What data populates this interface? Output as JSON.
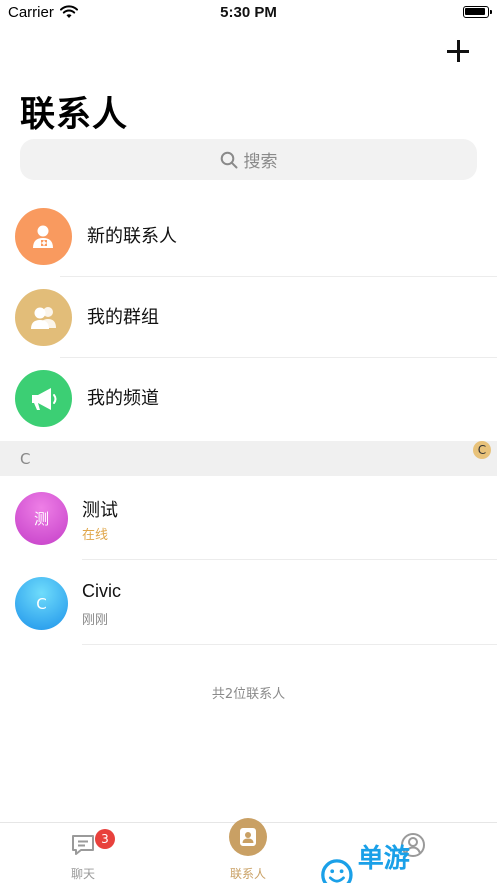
{
  "status_bar": {
    "carrier": "Carrier",
    "time": "5:30 PM"
  },
  "header": {
    "title": "联系人",
    "add_icon": "plus-icon"
  },
  "search": {
    "placeholder": "搜索",
    "icon": "search-icon"
  },
  "features": [
    {
      "label": "新的联系人",
      "icon": "add-user-icon",
      "color": "#f99a5f"
    },
    {
      "label": "我的群组",
      "icon": "group-icon",
      "color": "#e2bd79"
    },
    {
      "label": "我的频道",
      "icon": "megaphone-icon",
      "color": "#3ccf74"
    }
  ],
  "section": {
    "letter": "C",
    "index_badge": "C"
  },
  "contacts": [
    {
      "name": "测试",
      "status": "在线",
      "avatar_text": "测",
      "status_color": "#e0a64a"
    },
    {
      "name": "Civic",
      "status": "刚刚",
      "avatar_text": "C",
      "status_color": "#8a8a8a"
    }
  ],
  "total_text": "共2位联系人",
  "tabs": [
    {
      "label": "聊天",
      "badge": "3",
      "icon": "chat-icon",
      "active": false
    },
    {
      "label": "联系人",
      "icon": "contacts-icon",
      "active": true
    },
    {
      "label": "",
      "icon": "profile-icon",
      "active": false
    }
  ],
  "colors": {
    "accent": "#c9a064",
    "badge_red": "#e8413c"
  },
  "watermark": {
    "text": "单游网.com"
  }
}
